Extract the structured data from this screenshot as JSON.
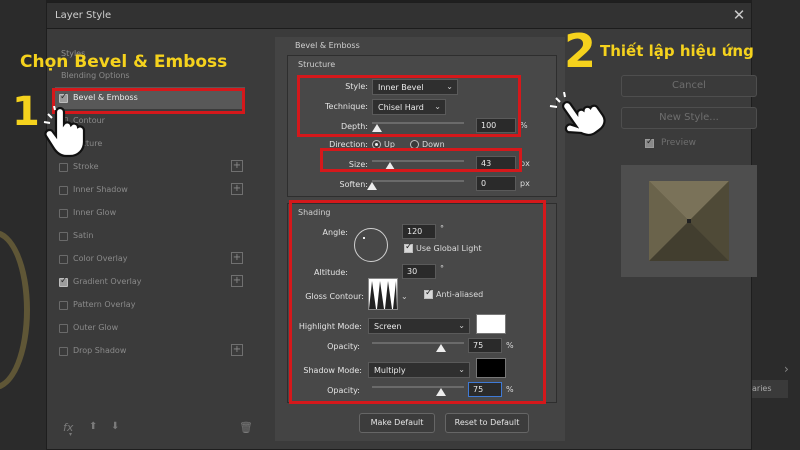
{
  "dialog": {
    "title": "Layer Style"
  },
  "left_panel": {
    "styles_header": "Styles",
    "blending_options": "Blending Options",
    "items": [
      {
        "label": "Bevel & Emboss",
        "checked": true,
        "plus": false,
        "active": true
      },
      {
        "label": "Contour",
        "checked": false,
        "plus": false
      },
      {
        "label": "Texture",
        "checked": false,
        "plus": false
      },
      {
        "label": "Stroke",
        "checked": false,
        "plus": true
      },
      {
        "label": "Inner Shadow",
        "checked": false,
        "plus": true
      },
      {
        "label": "Inner Glow",
        "checked": false,
        "plus": false
      },
      {
        "label": "Satin",
        "checked": false,
        "plus": false
      },
      {
        "label": "Color Overlay",
        "checked": false,
        "plus": true
      },
      {
        "label": "Gradient Overlay",
        "checked": true,
        "plus": true
      },
      {
        "label": "Pattern Overlay",
        "checked": false,
        "plus": false
      },
      {
        "label": "Outer Glow",
        "checked": false,
        "plus": false
      },
      {
        "label": "Drop Shadow",
        "checked": false,
        "plus": true
      }
    ],
    "fx_label": "fx"
  },
  "bevel": {
    "header": "Bevel & Emboss",
    "structure": "Structure",
    "style_label": "Style:",
    "style_value": "Inner Bevel",
    "technique_label": "Technique:",
    "technique_value": "Chisel Hard",
    "depth_label": "Depth:",
    "depth_value": "100",
    "depth_unit": "%",
    "direction_label": "Direction:",
    "direction_up": "Up",
    "direction_down": "Down",
    "size_label": "Size:",
    "size_value": "43",
    "size_unit": "px",
    "soften_label": "Soften:",
    "soften_value": "0",
    "soften_unit": "px"
  },
  "shading": {
    "header": "Shading",
    "angle_label": "Angle:",
    "angle_value": "120",
    "degree": "°",
    "use_global_light": "Use Global Light",
    "altitude_label": "Altitude:",
    "altitude_value": "30",
    "gloss_label": "Gloss Contour:",
    "anti_aliased": "Anti-aliased",
    "highlight_mode_label": "Highlight Mode:",
    "highlight_mode_value": "Screen",
    "highlight_color": "#ffffff",
    "opacity_label": "Opacity:",
    "highlight_opacity": "75",
    "shadow_mode_label": "Shadow Mode:",
    "shadow_mode_value": "Multiply",
    "shadow_color": "#000000",
    "shadow_opacity": "75",
    "percent": "%"
  },
  "buttons": {
    "make_default": "Make Default",
    "reset_default": "Reset to Default",
    "cancel": "Cancel",
    "new_style": "New Style...",
    "preview": "Preview",
    "bg_tab": "aries"
  },
  "annotations": {
    "num1": "1",
    "text1": "Chọn Bevel & Emboss",
    "num2": "2",
    "text2": "Thiết lập hiệu ứng",
    "accent": "#f5d21d",
    "box_color": "#d5181b"
  },
  "slider_levels": {
    "depth": 0.05,
    "size": 0.2,
    "soften": 0.0,
    "highlight_opacity": 0.75,
    "shadow_opacity": 0.75
  }
}
